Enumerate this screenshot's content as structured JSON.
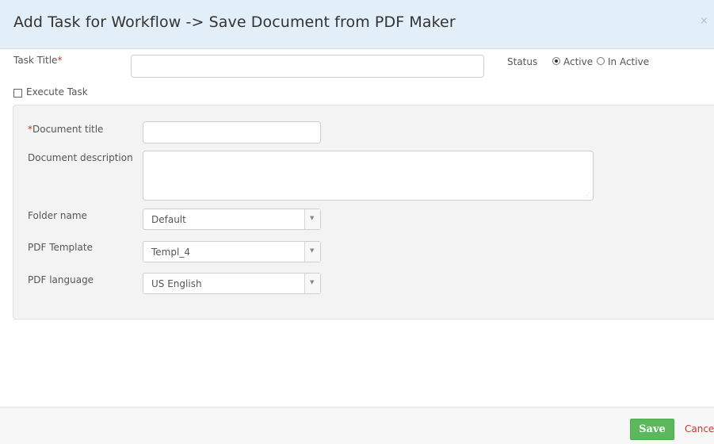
{
  "dialog": {
    "title": "Add Task for Workflow -> Save Document from PDF Maker",
    "close_glyph": "×"
  },
  "task": {
    "title_label": "Task Title",
    "required_mark": "*",
    "title_value": "",
    "status_label": "Status",
    "status_options": [
      {
        "label": "Active",
        "selected": true
      },
      {
        "label": "In Active",
        "selected": false
      }
    ],
    "execute_label": "Execute Task",
    "execute_checked": false
  },
  "document": {
    "title_required_mark": "*",
    "title_label": "Document title",
    "title_value": "",
    "description_label": "Document description",
    "description_value": "",
    "folder_label": "Folder name",
    "folder_value": "Default",
    "template_label": "PDF Template",
    "template_value": "Templ_4",
    "language_label": "PDF language",
    "language_value": "US English",
    "select_arrow": "▼",
    "resize_glyph": "⋰"
  },
  "footer": {
    "save_label": "Save",
    "cancel_label": "Cancel"
  },
  "colors": {
    "header_bg": "#e2eef8",
    "required": "#c0392b",
    "save_bg": "#5cb85c",
    "cancel_text": "#c0392b"
  }
}
